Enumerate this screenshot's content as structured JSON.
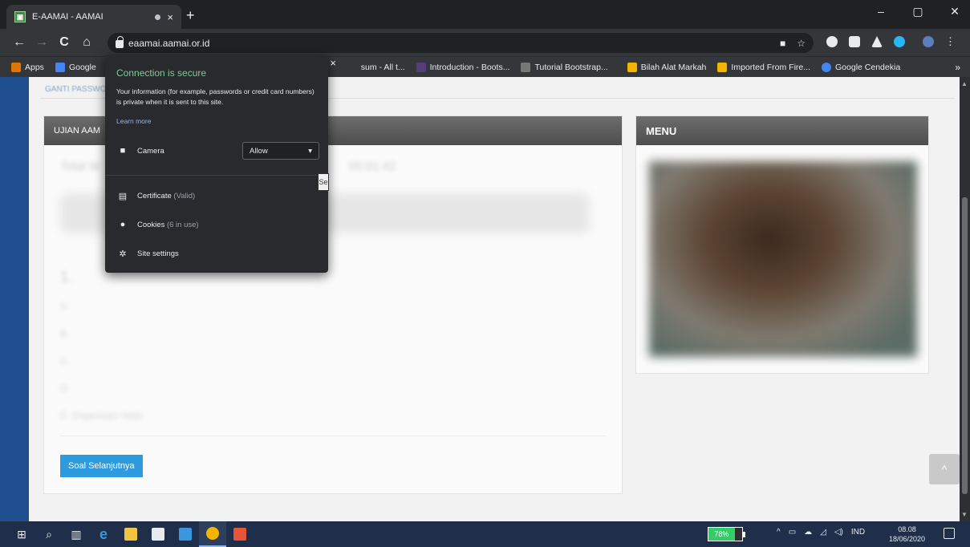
{
  "browser": {
    "tab_title": "E-AAMAI - AAMAI",
    "tab_close": "×",
    "new_tab": "+",
    "window_buttons": {
      "minimize": "–",
      "maximize": "▢",
      "close": "✕"
    },
    "nav": {
      "back": "←",
      "forward": "→",
      "reload": "C",
      "home": "⌂"
    },
    "url": "eaamai.aamai.or.id",
    "bookmarks": [
      {
        "label": "Apps",
        "color": "#e37400"
      },
      {
        "label": "Google",
        "color": "#4285f4"
      },
      {
        "label": "sum - All t...",
        "color": "#888888"
      },
      {
        "label": "Introduction - Boots...",
        "color": "#563d7c"
      },
      {
        "label": "Tutorial Bootstrap...",
        "color": "#777777"
      },
      {
        "label": "Bilah Alat Markah",
        "color": "#f4b400"
      },
      {
        "label": "Imported From Fire...",
        "color": "#f4b400"
      },
      {
        "label": "Google Cendekia",
        "color": "#4285f4"
      }
    ],
    "bookmarks_more": "»"
  },
  "site_info": {
    "title": "Connection is secure",
    "description": "Your information (for example, passwords or credit card numbers) is private when it is sent to this site.",
    "learn_more": "Learn more",
    "close": "×",
    "camera_label": "Camera",
    "camera_value": "Allow",
    "certificate_label": "Certificate",
    "certificate_status": "(Valid)",
    "cookies_label": "Cookies",
    "cookies_status": "(6 in use)",
    "site_settings_label": "Site settings",
    "side_tab": "Se"
  },
  "page": {
    "ganti_password": "GANTI PASSWORD",
    "left_panel_title": "UJIAN AAM",
    "total_time_label": "Total W",
    "time_value": "00:01:42",
    "question_number": "1.",
    "options": [
      "A.",
      "B.",
      "C.",
      "D.",
      "E.  Organisasi Halal"
    ],
    "next_button": "Soal Selanjutnya",
    "right_panel_title": "MENU",
    "back_to_top": "^"
  },
  "taskbar": {
    "battery": "78%",
    "battery_level": 0.78,
    "tray_lang": "IND",
    "time": "08.08",
    "date": "18/06/2020"
  }
}
